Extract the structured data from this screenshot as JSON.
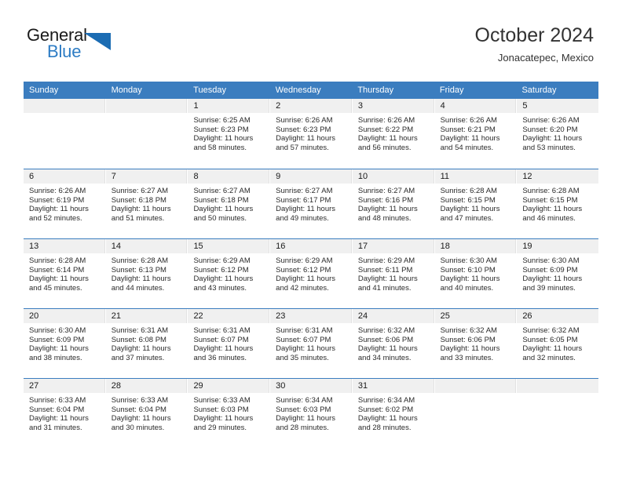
{
  "brand": {
    "word_one": "General",
    "word_two": "Blue",
    "triangle_color": "#1b6cb3",
    "blue_text_color": "#2d7cc4"
  },
  "header": {
    "title": "October 2024",
    "subtitle": "Jonacatepec, Mexico"
  },
  "calendar": {
    "header_bg": "#3b7dbf",
    "daynum_bg": "#f0f0f0",
    "weekdays": [
      "Sunday",
      "Monday",
      "Tuesday",
      "Wednesday",
      "Thursday",
      "Friday",
      "Saturday"
    ],
    "weeks": [
      [
        {
          "day": "",
          "sunrise": "",
          "sunset": "",
          "daylight_line1": "",
          "daylight_line2": ""
        },
        {
          "day": "",
          "sunrise": "",
          "sunset": "",
          "daylight_line1": "",
          "daylight_line2": ""
        },
        {
          "day": "1",
          "sunrise": "Sunrise: 6:25 AM",
          "sunset": "Sunset: 6:23 PM",
          "daylight_line1": "Daylight: 11 hours",
          "daylight_line2": "and 58 minutes."
        },
        {
          "day": "2",
          "sunrise": "Sunrise: 6:26 AM",
          "sunset": "Sunset: 6:23 PM",
          "daylight_line1": "Daylight: 11 hours",
          "daylight_line2": "and 57 minutes."
        },
        {
          "day": "3",
          "sunrise": "Sunrise: 6:26 AM",
          "sunset": "Sunset: 6:22 PM",
          "daylight_line1": "Daylight: 11 hours",
          "daylight_line2": "and 56 minutes."
        },
        {
          "day": "4",
          "sunrise": "Sunrise: 6:26 AM",
          "sunset": "Sunset: 6:21 PM",
          "daylight_line1": "Daylight: 11 hours",
          "daylight_line2": "and 54 minutes."
        },
        {
          "day": "5",
          "sunrise": "Sunrise: 6:26 AM",
          "sunset": "Sunset: 6:20 PM",
          "daylight_line1": "Daylight: 11 hours",
          "daylight_line2": "and 53 minutes."
        }
      ],
      [
        {
          "day": "6",
          "sunrise": "Sunrise: 6:26 AM",
          "sunset": "Sunset: 6:19 PM",
          "daylight_line1": "Daylight: 11 hours",
          "daylight_line2": "and 52 minutes."
        },
        {
          "day": "7",
          "sunrise": "Sunrise: 6:27 AM",
          "sunset": "Sunset: 6:18 PM",
          "daylight_line1": "Daylight: 11 hours",
          "daylight_line2": "and 51 minutes."
        },
        {
          "day": "8",
          "sunrise": "Sunrise: 6:27 AM",
          "sunset": "Sunset: 6:18 PM",
          "daylight_line1": "Daylight: 11 hours",
          "daylight_line2": "and 50 minutes."
        },
        {
          "day": "9",
          "sunrise": "Sunrise: 6:27 AM",
          "sunset": "Sunset: 6:17 PM",
          "daylight_line1": "Daylight: 11 hours",
          "daylight_line2": "and 49 minutes."
        },
        {
          "day": "10",
          "sunrise": "Sunrise: 6:27 AM",
          "sunset": "Sunset: 6:16 PM",
          "daylight_line1": "Daylight: 11 hours",
          "daylight_line2": "and 48 minutes."
        },
        {
          "day": "11",
          "sunrise": "Sunrise: 6:28 AM",
          "sunset": "Sunset: 6:15 PM",
          "daylight_line1": "Daylight: 11 hours",
          "daylight_line2": "and 47 minutes."
        },
        {
          "day": "12",
          "sunrise": "Sunrise: 6:28 AM",
          "sunset": "Sunset: 6:15 PM",
          "daylight_line1": "Daylight: 11 hours",
          "daylight_line2": "and 46 minutes."
        }
      ],
      [
        {
          "day": "13",
          "sunrise": "Sunrise: 6:28 AM",
          "sunset": "Sunset: 6:14 PM",
          "daylight_line1": "Daylight: 11 hours",
          "daylight_line2": "and 45 minutes."
        },
        {
          "day": "14",
          "sunrise": "Sunrise: 6:28 AM",
          "sunset": "Sunset: 6:13 PM",
          "daylight_line1": "Daylight: 11 hours",
          "daylight_line2": "and 44 minutes."
        },
        {
          "day": "15",
          "sunrise": "Sunrise: 6:29 AM",
          "sunset": "Sunset: 6:12 PM",
          "daylight_line1": "Daylight: 11 hours",
          "daylight_line2": "and 43 minutes."
        },
        {
          "day": "16",
          "sunrise": "Sunrise: 6:29 AM",
          "sunset": "Sunset: 6:12 PM",
          "daylight_line1": "Daylight: 11 hours",
          "daylight_line2": "and 42 minutes."
        },
        {
          "day": "17",
          "sunrise": "Sunrise: 6:29 AM",
          "sunset": "Sunset: 6:11 PM",
          "daylight_line1": "Daylight: 11 hours",
          "daylight_line2": "and 41 minutes."
        },
        {
          "day": "18",
          "sunrise": "Sunrise: 6:30 AM",
          "sunset": "Sunset: 6:10 PM",
          "daylight_line1": "Daylight: 11 hours",
          "daylight_line2": "and 40 minutes."
        },
        {
          "day": "19",
          "sunrise": "Sunrise: 6:30 AM",
          "sunset": "Sunset: 6:09 PM",
          "daylight_line1": "Daylight: 11 hours",
          "daylight_line2": "and 39 minutes."
        }
      ],
      [
        {
          "day": "20",
          "sunrise": "Sunrise: 6:30 AM",
          "sunset": "Sunset: 6:09 PM",
          "daylight_line1": "Daylight: 11 hours",
          "daylight_line2": "and 38 minutes."
        },
        {
          "day": "21",
          "sunrise": "Sunrise: 6:31 AM",
          "sunset": "Sunset: 6:08 PM",
          "daylight_line1": "Daylight: 11 hours",
          "daylight_line2": "and 37 minutes."
        },
        {
          "day": "22",
          "sunrise": "Sunrise: 6:31 AM",
          "sunset": "Sunset: 6:07 PM",
          "daylight_line1": "Daylight: 11 hours",
          "daylight_line2": "and 36 minutes."
        },
        {
          "day": "23",
          "sunrise": "Sunrise: 6:31 AM",
          "sunset": "Sunset: 6:07 PM",
          "daylight_line1": "Daylight: 11 hours",
          "daylight_line2": "and 35 minutes."
        },
        {
          "day": "24",
          "sunrise": "Sunrise: 6:32 AM",
          "sunset": "Sunset: 6:06 PM",
          "daylight_line1": "Daylight: 11 hours",
          "daylight_line2": "and 34 minutes."
        },
        {
          "day": "25",
          "sunrise": "Sunrise: 6:32 AM",
          "sunset": "Sunset: 6:06 PM",
          "daylight_line1": "Daylight: 11 hours",
          "daylight_line2": "and 33 minutes."
        },
        {
          "day": "26",
          "sunrise": "Sunrise: 6:32 AM",
          "sunset": "Sunset: 6:05 PM",
          "daylight_line1": "Daylight: 11 hours",
          "daylight_line2": "and 32 minutes."
        }
      ],
      [
        {
          "day": "27",
          "sunrise": "Sunrise: 6:33 AM",
          "sunset": "Sunset: 6:04 PM",
          "daylight_line1": "Daylight: 11 hours",
          "daylight_line2": "and 31 minutes."
        },
        {
          "day": "28",
          "sunrise": "Sunrise: 6:33 AM",
          "sunset": "Sunset: 6:04 PM",
          "daylight_line1": "Daylight: 11 hours",
          "daylight_line2": "and 30 minutes."
        },
        {
          "day": "29",
          "sunrise": "Sunrise: 6:33 AM",
          "sunset": "Sunset: 6:03 PM",
          "daylight_line1": "Daylight: 11 hours",
          "daylight_line2": "and 29 minutes."
        },
        {
          "day": "30",
          "sunrise": "Sunrise: 6:34 AM",
          "sunset": "Sunset: 6:03 PM",
          "daylight_line1": "Daylight: 11 hours",
          "daylight_line2": "and 28 minutes."
        },
        {
          "day": "31",
          "sunrise": "Sunrise: 6:34 AM",
          "sunset": "Sunset: 6:02 PM",
          "daylight_line1": "Daylight: 11 hours",
          "daylight_line2": "and 28 minutes."
        },
        {
          "day": "",
          "sunrise": "",
          "sunset": "",
          "daylight_line1": "",
          "daylight_line2": ""
        },
        {
          "day": "",
          "sunrise": "",
          "sunset": "",
          "daylight_line1": "",
          "daylight_line2": ""
        }
      ]
    ]
  }
}
